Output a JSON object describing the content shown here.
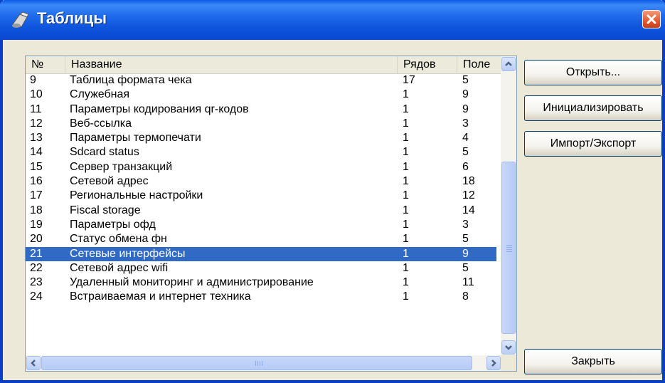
{
  "window": {
    "title": "Таблицы"
  },
  "list": {
    "columns": [
      "№",
      "Название",
      "Рядов",
      "Поле"
    ],
    "rows": [
      [
        "9",
        "Таблица формата чека",
        "17",
        "5"
      ],
      [
        "10",
        "Служебная",
        "1",
        "9"
      ],
      [
        "11",
        "Параметры кодирования qr-кодов",
        "1",
        "9"
      ],
      [
        "12",
        "Веб-ссылка",
        "1",
        "3"
      ],
      [
        "13",
        "Параметры термопечати",
        "1",
        "4"
      ],
      [
        "14",
        "Sdcard status",
        "1",
        "5"
      ],
      [
        "15",
        "Сервер транзакций",
        "1",
        "6"
      ],
      [
        "16",
        "Сетевой адрес",
        "1",
        "18"
      ],
      [
        "17",
        "Региональные настройки",
        "1",
        "12"
      ],
      [
        "18",
        "Fiscal storage",
        "1",
        "14"
      ],
      [
        "19",
        "Параметры офд",
        "1",
        "3"
      ],
      [
        "20",
        "Статус обмена фн",
        "1",
        "5"
      ],
      [
        "21",
        "Сетевые интерфейсы",
        "1",
        "9"
      ],
      [
        "22",
        "Сетевой адрес wifi",
        "1",
        "5"
      ],
      [
        "23",
        "Удаленный мониторинг и администрирование",
        "1",
        "11"
      ],
      [
        "24",
        "Встраиваемая и интернет техника",
        "1",
        "8"
      ]
    ],
    "selected_row": "21"
  },
  "buttons": {
    "open": "Открыть...",
    "initialize": "Инициализировать",
    "import_export": "Импорт/Экспорт",
    "close": "Закрыть"
  },
  "colors": {
    "selection": "#316ac5",
    "titlebar": "#0a53dc"
  }
}
